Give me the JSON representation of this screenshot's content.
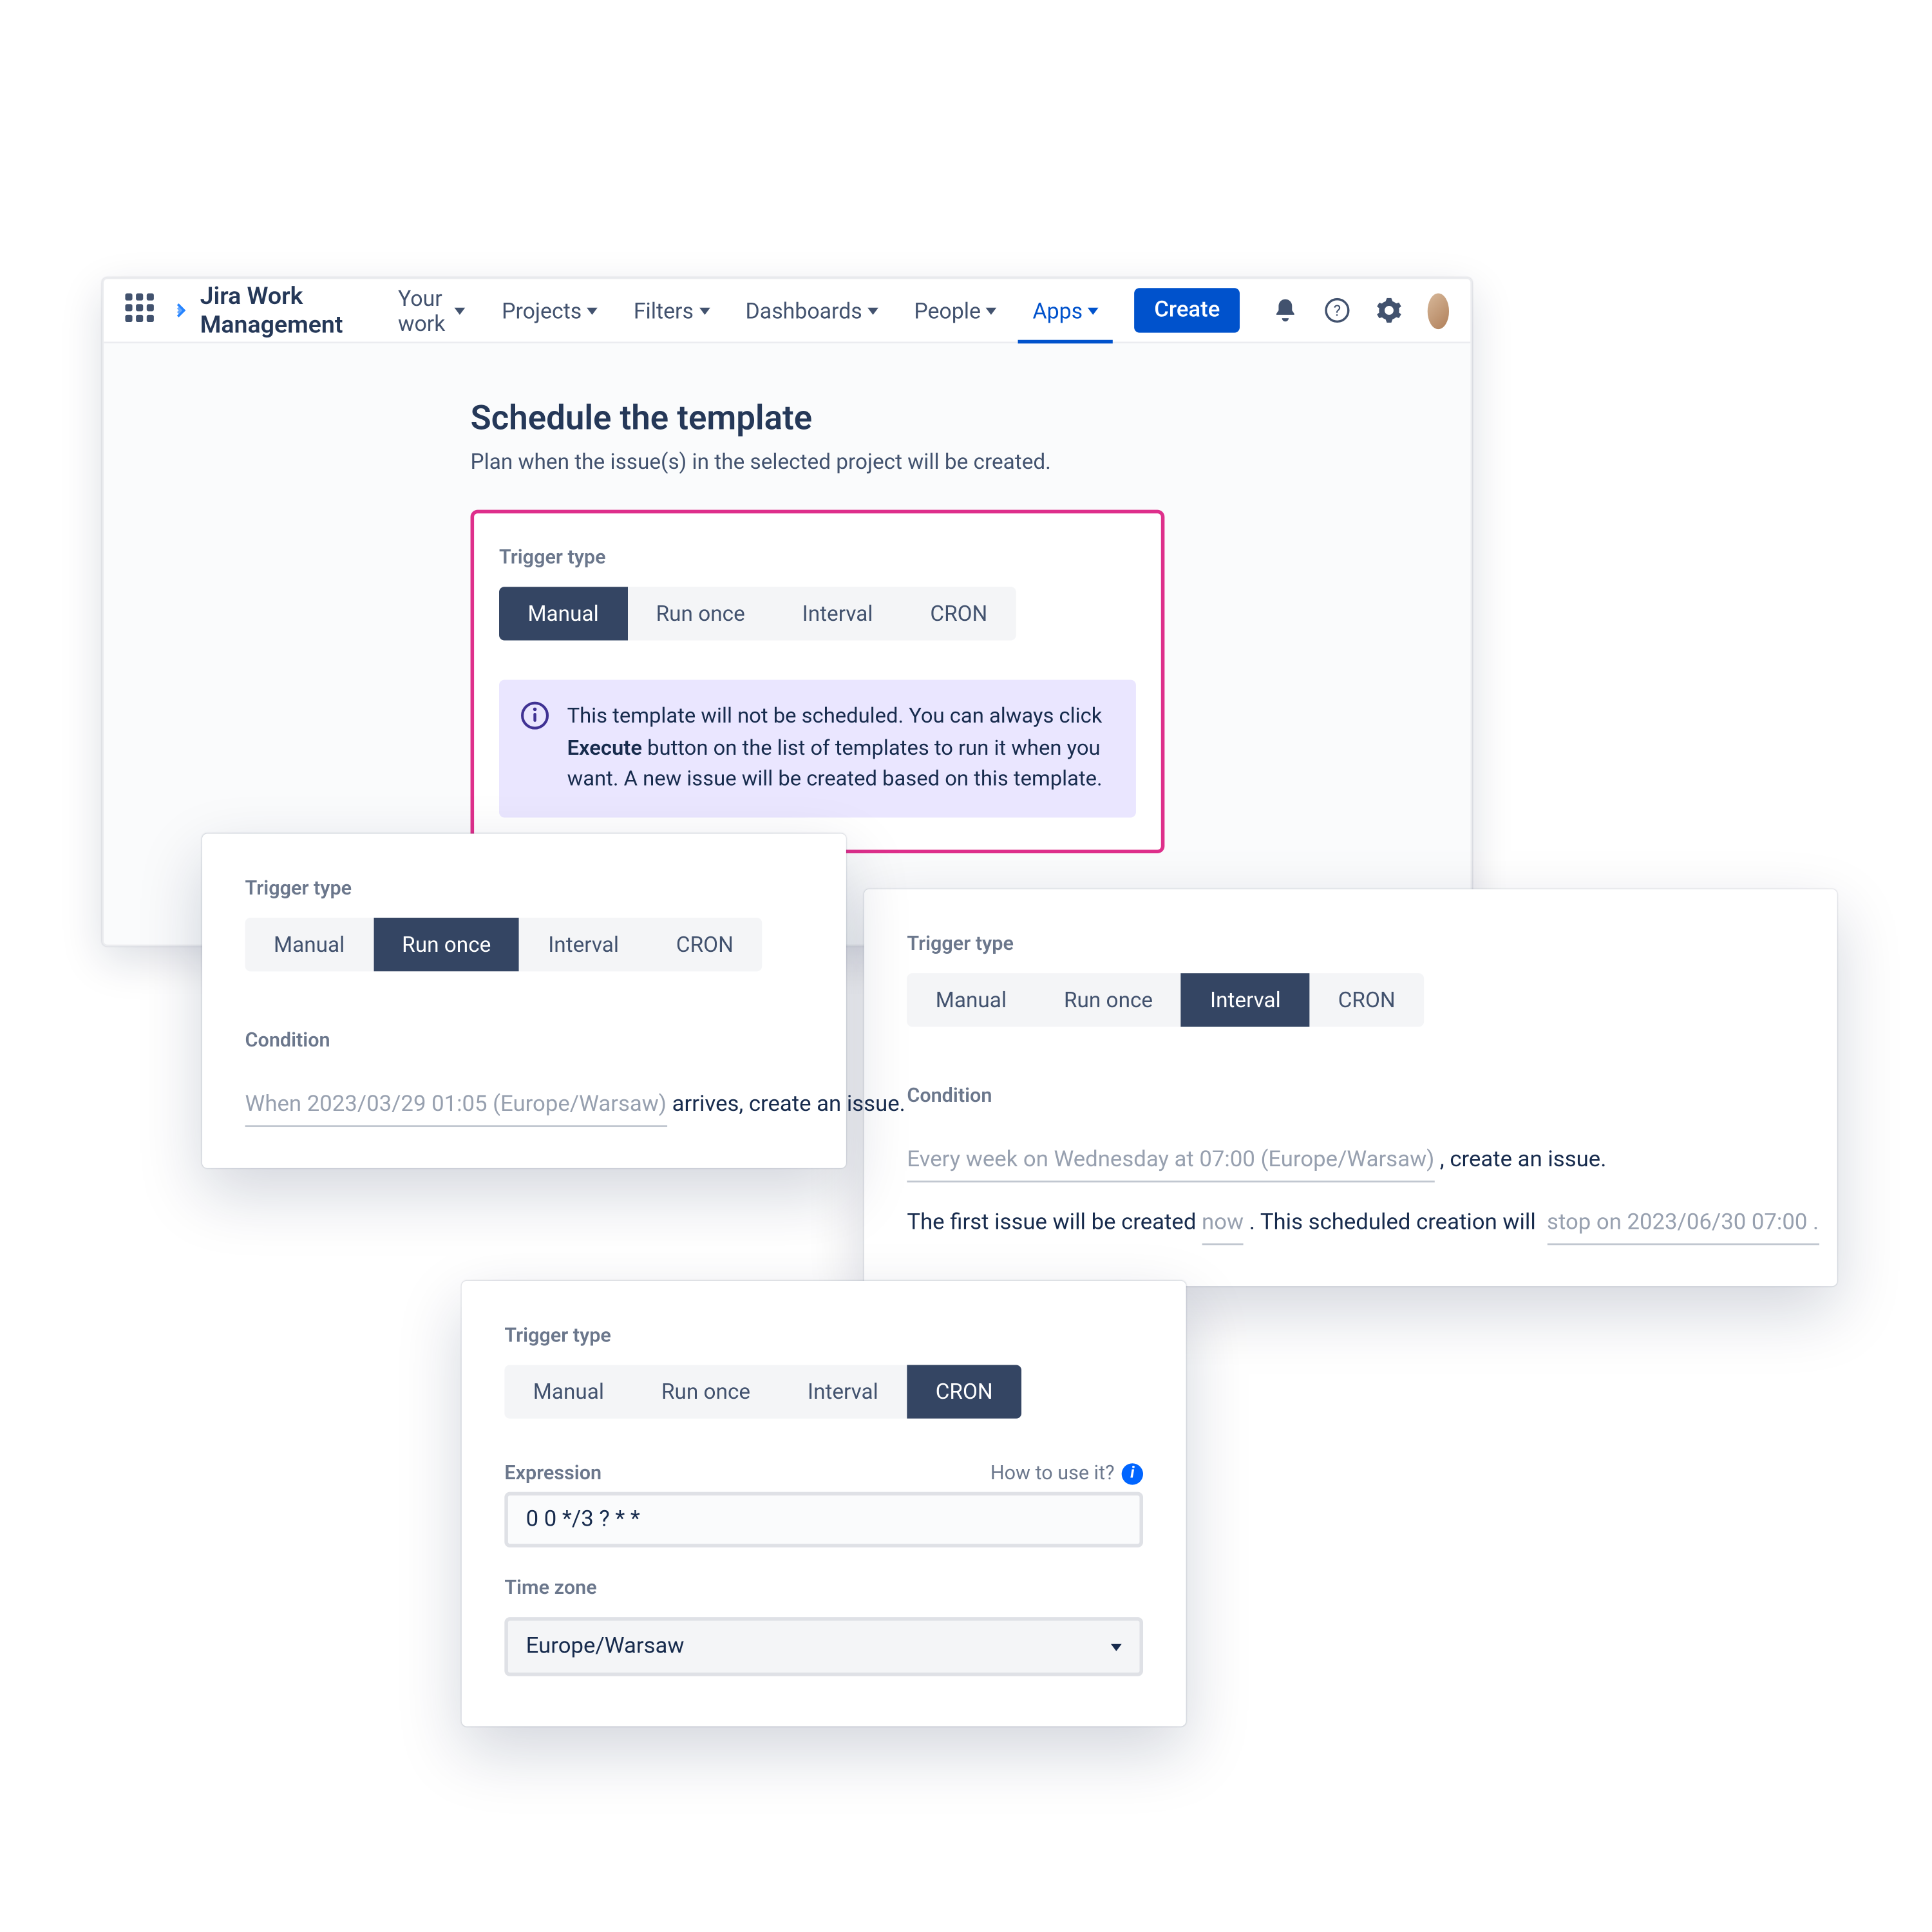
{
  "topbar": {
    "product": "Jira Work Management",
    "nav": {
      "your_work": "Your work",
      "projects": "Projects",
      "filters": "Filters",
      "dashboards": "Dashboards",
      "people": "People",
      "apps": "Apps"
    },
    "create": "Create"
  },
  "page": {
    "title": "Schedule the template",
    "subtitle": "Plan when the issue(s) in the selected project will be created."
  },
  "trigger_label": "Trigger type",
  "trigger_options": {
    "manual": "Manual",
    "run_once": "Run once",
    "interval": "Interval",
    "cron": "CRON"
  },
  "banner": {
    "prefix": "This template will not be scheduled. You can always click ",
    "bold": "Execute",
    "suffix": " button on the list of templates to run it when you want. A new issue will be created based on this template."
  },
  "condition_label": "Condition",
  "runonce": {
    "ghost": "When 2023/03/29 01:05 (Europe/Warsaw)",
    "rest": " arrives, create an issue."
  },
  "interval": {
    "ghost1": "Every week on Wednesday at 07:00 (Europe/Warsaw)",
    "rest1": " , create an issue.",
    "line2a": "The first issue will be created ",
    "ghost2": "now",
    "line2b": " . This scheduled creation will ",
    "ghost3": "stop on 2023/06/30 07:00 ."
  },
  "cron": {
    "expression_label": "Expression",
    "howto": "How to use it?",
    "expression_value": "0 0 */3 ? * *",
    "tz_label": "Time zone",
    "tz_value": "Europe/Warsaw"
  }
}
